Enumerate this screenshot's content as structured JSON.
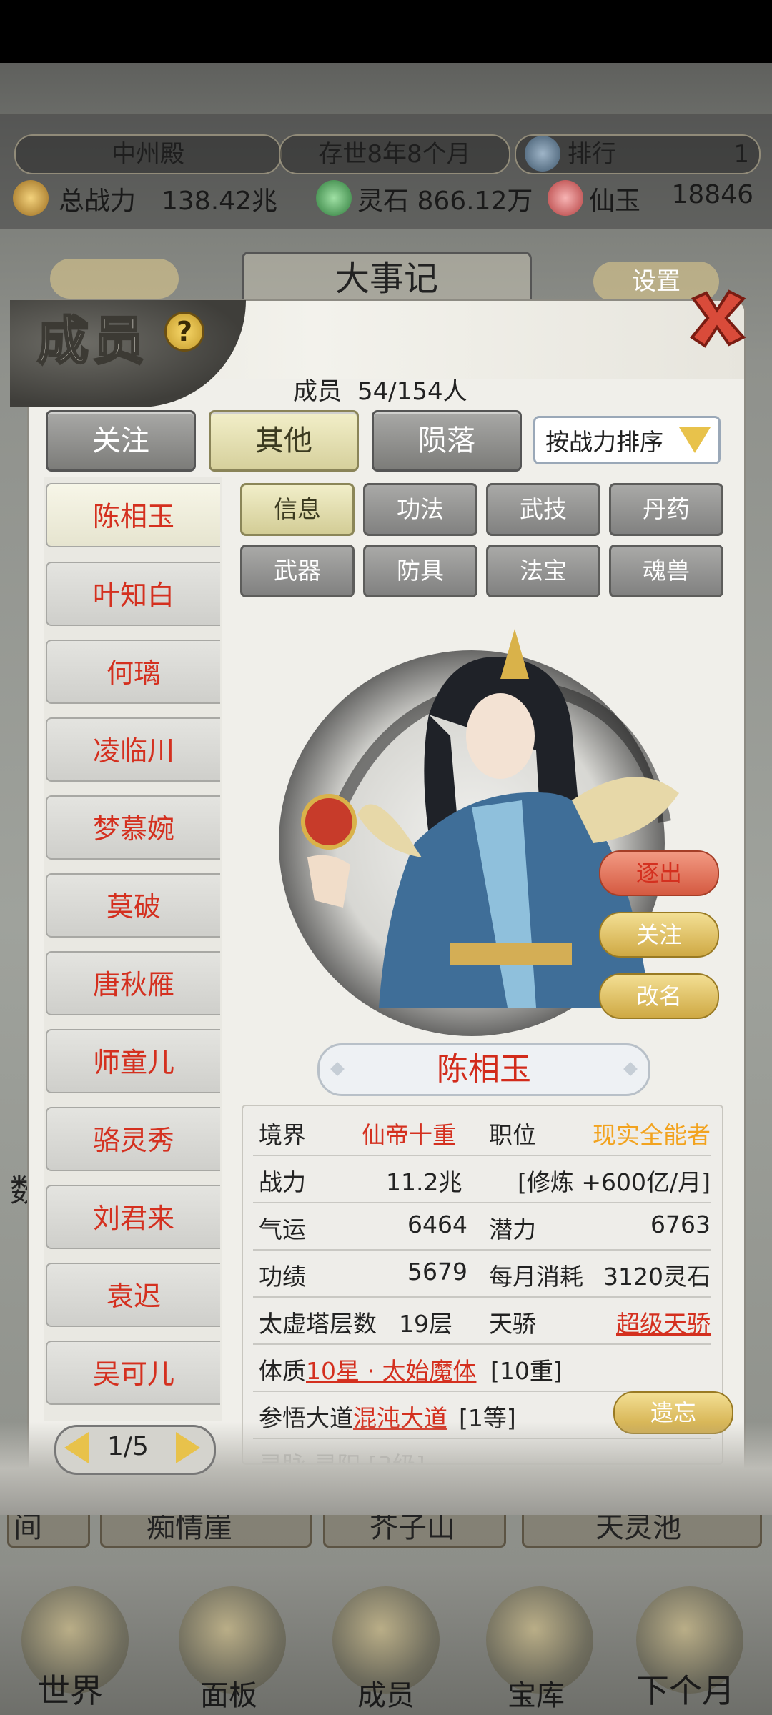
{
  "top_info": {
    "sect_name": "中州殿",
    "age": "存世8年8个月",
    "rank_label": "排行",
    "rank_value": "1",
    "power_label": "总战力",
    "power_value": "138.42兆",
    "spirit_stone": "灵石 866.12万",
    "jade_label": "仙玉",
    "jade_value": "18846"
  },
  "background": {
    "event_label": "大事记",
    "settings_label": "设置",
    "row_labels": [
      "间",
      "痴情崖",
      "芥子山",
      "天灵池"
    ],
    "side_char": "数"
  },
  "panel": {
    "title": "成员",
    "help": "?",
    "count_label": "成员",
    "count_value": "54/154人",
    "tabs": [
      "关注",
      "其他",
      "陨落"
    ],
    "sort_label": "按战力排序",
    "members": [
      "陈相玉",
      "叶知白",
      "何璃",
      "凌临川",
      "梦慕婉",
      "莫破",
      "唐秋雁",
      "师童儿",
      "骆灵秀",
      "刘君来",
      "袁迟",
      "吴可儿"
    ],
    "pager": "1/5",
    "sub_tabs": [
      "信息",
      "功法",
      "武技",
      "丹药",
      "武器",
      "防具",
      "法宝",
      "魂兽"
    ],
    "actions": [
      "逐出",
      "关注",
      "改名"
    ],
    "selected_name": "陈相玉",
    "info": {
      "realm_label": "境界",
      "realm_value": "仙帝十重",
      "position_label": "职位",
      "position_value": "现实全能者",
      "power_label": "战力",
      "power_value": "11.2兆",
      "cultivation": "[修炼 +600亿/月]",
      "luck_label": "气运",
      "luck_value": "6464",
      "potential_label": "潜力",
      "potential_value": "6763",
      "merit_label": "功绩",
      "merit_value": "5679",
      "cost_label": "每月消耗",
      "cost_value": "3120灵石",
      "tower_label": "太虚塔层数",
      "tower_value": "19层",
      "talent_label": "天骄",
      "talent_value": "超级天骄",
      "physique_label": "体质",
      "physique_value": "10星 · 太始魔体",
      "physique_level": "[10重]",
      "dao_label": "参悟大道",
      "dao_value": "混沌大道",
      "dao_level": "[1等]",
      "forget_label": "遗忘",
      "partial_row": "灵脉 灵阳 [3级]"
    }
  },
  "bottom_nav": [
    "世界",
    "面板",
    "成员",
    "宝库",
    "下个月"
  ]
}
